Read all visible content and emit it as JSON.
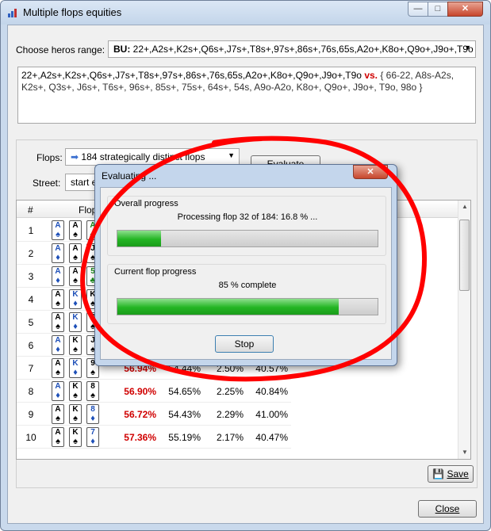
{
  "window": {
    "title": "Multiple flops equities",
    "min": "—",
    "max": "□",
    "close": "✕"
  },
  "range": {
    "label": "Choose heros range:",
    "selected_prefix": "BU:",
    "selected_value": "22+,A2s+,K2s+,Q6s+,J7s+,T8s+,97s+,86s+,76s,65s,A2o+,K8o+,Q9o+,J9o+,T9o",
    "hero_text": "22+,A2s+,K2s+,Q6s+,J7s+,T8s+,97s+,86s+,76s,65s,A2o+,K8o+,Q9o+,J9o+,T9o",
    "vs_label": "vs.",
    "villain_text": "{ 66-22, A8s-A2s, K2s+, Q3s+, J6s+, T6s+, 96s+, 85s+, 75s+, 64s+, 54s, A9o-A2o, K8o+, Q9o+, J9o+, T9o, 98o }"
  },
  "flops": {
    "label": "Flops:",
    "value": "184 strategically distinct flops"
  },
  "street": {
    "label": "Street:",
    "value": "start evaluation (turn)"
  },
  "evaluate_button": "Evaluate",
  "table": {
    "col_num": "#",
    "col_flop": "Flop",
    "rows": [
      {
        "n": "1",
        "c": [
          [
            "A",
            "♠",
            "b"
          ],
          [
            "A",
            "♠",
            "k"
          ],
          [
            "A",
            "♣",
            "g"
          ]
        ],
        "v": [
          "",
          "",
          "",
          ""
        ]
      },
      {
        "n": "2",
        "c": [
          [
            "A",
            "♦",
            "b"
          ],
          [
            "A",
            "♠",
            "k"
          ],
          [
            "J",
            "♠",
            "k"
          ]
        ],
        "v": [
          "",
          "",
          "",
          ""
        ]
      },
      {
        "n": "3",
        "c": [
          [
            "A",
            "♦",
            "b"
          ],
          [
            "A",
            "♠",
            "k"
          ],
          [
            "5",
            "♣",
            "g"
          ]
        ],
        "v": [
          "",
          "",
          "",
          ""
        ]
      },
      {
        "n": "4",
        "c": [
          [
            "A",
            "♠",
            "k"
          ],
          [
            "K",
            "♦",
            "b"
          ],
          [
            "K",
            "♠",
            "k"
          ]
        ],
        "v": [
          "",
          "",
          "",
          ""
        ]
      },
      {
        "n": "5",
        "c": [
          [
            "A",
            "♠",
            "k"
          ],
          [
            "K",
            "♦",
            "b"
          ],
          [
            "Q",
            "♠",
            "k"
          ]
        ],
        "v": [
          "",
          "",
          "",
          ""
        ]
      },
      {
        "n": "6",
        "c": [
          [
            "A",
            "♦",
            "b"
          ],
          [
            "K",
            "♠",
            "k"
          ],
          [
            "J",
            "♠",
            "k"
          ]
        ],
        "v": [
          "",
          "",
          "",
          ""
        ]
      },
      {
        "n": "7",
        "c": [
          [
            "A",
            "♠",
            "k"
          ],
          [
            "K",
            "♦",
            "b"
          ],
          [
            "9",
            "♠",
            "k"
          ]
        ],
        "v": [
          "56.94%",
          "54.44%",
          "2.50%",
          "40.57%"
        ]
      },
      {
        "n": "8",
        "c": [
          [
            "A",
            "♦",
            "b"
          ],
          [
            "K",
            "♠",
            "k"
          ],
          [
            "8",
            "♠",
            "k"
          ]
        ],
        "v": [
          "56.90%",
          "54.65%",
          "2.25%",
          "40.84%"
        ]
      },
      {
        "n": "9",
        "c": [
          [
            "A",
            "♠",
            "k"
          ],
          [
            "K",
            "♠",
            "k"
          ],
          [
            "8",
            "♦",
            "b"
          ]
        ],
        "v": [
          "56.72%",
          "54.43%",
          "2.29%",
          "41.00%"
        ]
      },
      {
        "n": "10",
        "c": [
          [
            "A",
            "♠",
            "k"
          ],
          [
            "K",
            "♠",
            "k"
          ],
          [
            "7",
            "♦",
            "b"
          ]
        ],
        "v": [
          "57.36%",
          "55.19%",
          "2.17%",
          "40.47%"
        ]
      }
    ]
  },
  "save_button": "Save",
  "close_button": "Close",
  "dialog": {
    "title": "Evaluating ...",
    "overall_title": "Overall progress",
    "overall_text": "Processing flop 32 of 184: 16.8 % ...",
    "overall_fraction": 0.168,
    "current_title": "Current flop progress",
    "current_text": "85 % complete",
    "current_fraction": 0.85,
    "stop_button": "Stop"
  },
  "colors": {
    "accent": "#d00000",
    "progress": "#23b523",
    "annotation": "#ff0000"
  }
}
